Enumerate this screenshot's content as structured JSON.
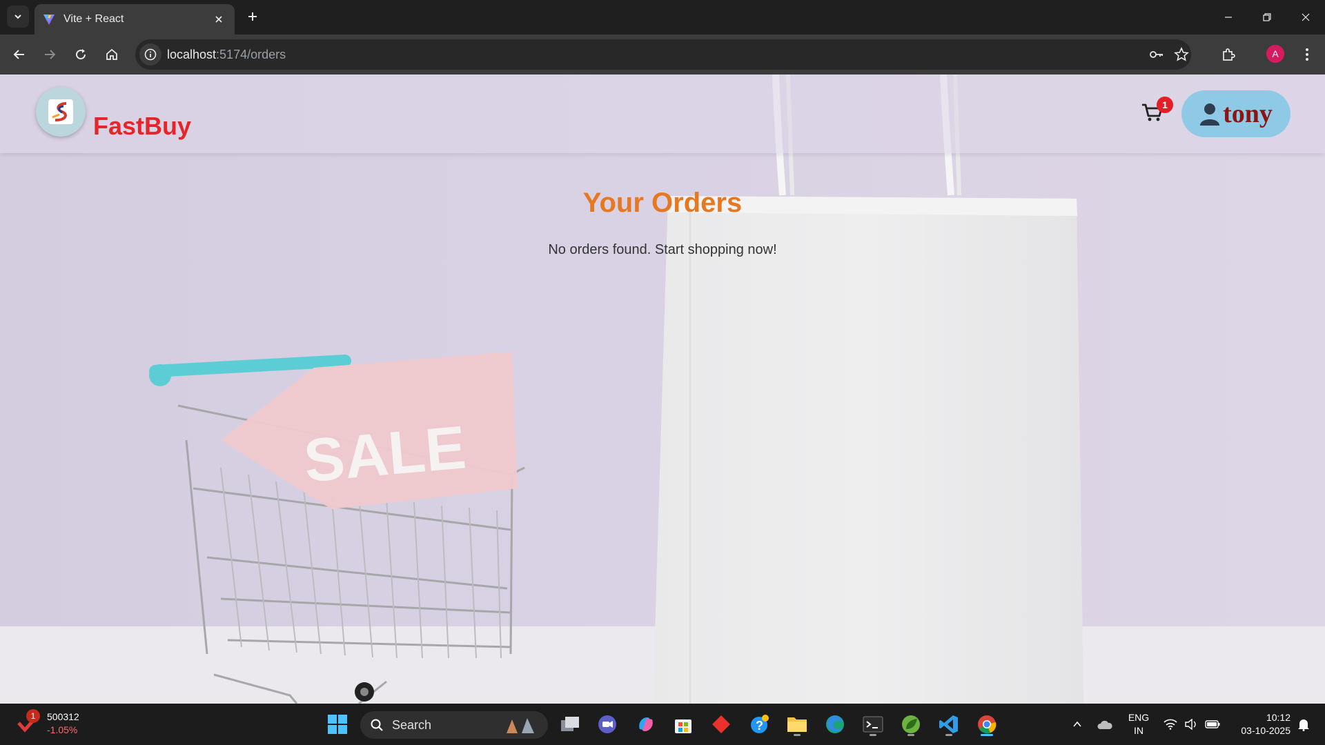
{
  "browser": {
    "tab_title": "Vite + React",
    "url_host": "localhost",
    "url_path": ":5174/orders"
  },
  "site": {
    "brand": "FastBuy",
    "cart_count": "1",
    "user_name": "tony",
    "orders_title": "Your Orders",
    "orders_empty": "No orders found. Start shopping now!",
    "hero_sale_text": "SALE"
  },
  "taskbar": {
    "widget_badge": "1",
    "widget_value": "500312",
    "widget_change": "-1.05%",
    "search_label": "Search",
    "lang_1": "ENG",
    "lang_2": "IN",
    "time": "10:12",
    "date": "03-10-2025",
    "profile_initial": "A"
  },
  "colors": {
    "brand_red": "#e4262a",
    "title_orange": "#e77822",
    "user_button": "#8ecae6",
    "user_text": "#8b1414"
  },
  "icons": [
    "tab-search-icon",
    "vite-favicon",
    "close-icon",
    "plus-icon",
    "minimize-icon",
    "restore-icon",
    "back-icon",
    "forward-icon",
    "reload-icon",
    "home-icon",
    "site-info-icon",
    "password-key-icon",
    "star-icon",
    "extensions-icon",
    "cart-icon",
    "user-icon",
    "windows-start-icon",
    "search-icon"
  ]
}
